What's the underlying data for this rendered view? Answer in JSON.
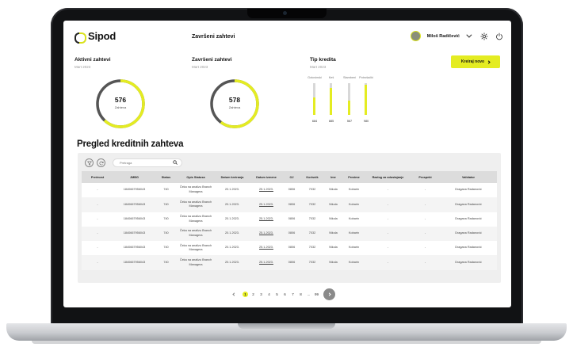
{
  "app": {
    "logo": "Sipod",
    "header_title": "Završeni zahtevi"
  },
  "user": {
    "name": "Miloš Radičević"
  },
  "cards": [
    {
      "title": "Aktivni zahtevi",
      "subtitle": "Mart 2023",
      "value": "576",
      "label": "Zahteva",
      "fraction": 0.62
    },
    {
      "title": "Završeni zahtevi",
      "subtitle": "Mart 2023",
      "value": "578",
      "label": "Zahteva",
      "fraction": 0.6
    }
  ],
  "credit_type": {
    "title": "Tip kredita",
    "subtitle": "Mart 2023",
    "bars": [
      {
        "label": "Gotovinski",
        "value": "684",
        "fraction": 0.55
      },
      {
        "label": "Keš",
        "value": "885",
        "fraction": 0.85
      },
      {
        "label": "Stambeni",
        "value": "567",
        "fraction": 0.45
      },
      {
        "label": "Potrošački",
        "value": "980",
        "fraction": 0.95
      }
    ]
  },
  "create_button": {
    "label": "Kreiraj novo"
  },
  "section": {
    "title": "Pregled kreditnih zahteva"
  },
  "search": {
    "placeholder": "Pretraga"
  },
  "table": {
    "columns": [
      "Prečnost",
      "JMBG",
      "Status",
      "Opis Statusa",
      "Datum kreiranja",
      "Datum izmene",
      "OJ",
      "Korisnik",
      "Ime",
      "Prezime",
      "Razlog za odustajanje",
      "Prospekt",
      "Validator"
    ],
    "rows": [
      [
        "-",
        "1840667956043",
        "740",
        "Čeka na analizu Branch Managera",
        "20.1.2023.",
        "25.1.2023.",
        "0806",
        "7032",
        "Nikola",
        "Kobarin",
        "-",
        "-",
        "Dragana Radanović"
      ],
      [
        "-",
        "1840667956043",
        "740",
        "Čeka na analizu Branch Managera",
        "20.1.2023.",
        "25.1.2023.",
        "0806",
        "7032",
        "Nikola",
        "Kobarin",
        "-",
        "-",
        "Dragana Radanović"
      ],
      [
        "-",
        "1840667956043",
        "740",
        "Čeka na analizu Branch Managera",
        "20.1.2023.",
        "25.1.2023.",
        "0806",
        "7032",
        "Nikola",
        "Kobarin",
        "-",
        "-",
        "Dragana Radanović"
      ],
      [
        "-",
        "1840667956043",
        "740",
        "Čeka na analizu Branch Managera",
        "20.1.2023.",
        "25.1.2023.",
        "0806",
        "7032",
        "Nikola",
        "Kobarin",
        "-",
        "-",
        "Dragana Radanović"
      ],
      [
        "-",
        "1840667956043",
        "740",
        "Čeka na analizu Branch Managera",
        "20.1.2023.",
        "25.1.2023.",
        "0806",
        "7032",
        "Nikola",
        "Kobarin",
        "-",
        "-",
        "Dragana Radanović"
      ],
      [
        "-",
        "1840667956043",
        "740",
        "Čeka na analizu Branch Managera",
        "20.1.2023.",
        "25.1.2023.",
        "0806",
        "7032",
        "Nikola",
        "Kobarin",
        "-",
        "-",
        "Dragana Radanović"
      ]
    ]
  },
  "pagination": {
    "pages": [
      "1",
      "2",
      "3",
      "4",
      "5",
      "6",
      "7",
      "8",
      "...",
      "99"
    ],
    "current": "1"
  },
  "colors": {
    "accent": "#e4ec22",
    "ring_dark": "#555555",
    "panel": "#efefef"
  },
  "icons": [
    "filter-icon",
    "refresh-icon",
    "search-icon",
    "gear-icon",
    "power-icon",
    "chevron-down-icon",
    "chevron-left-icon",
    "chevron-right-icon"
  ]
}
